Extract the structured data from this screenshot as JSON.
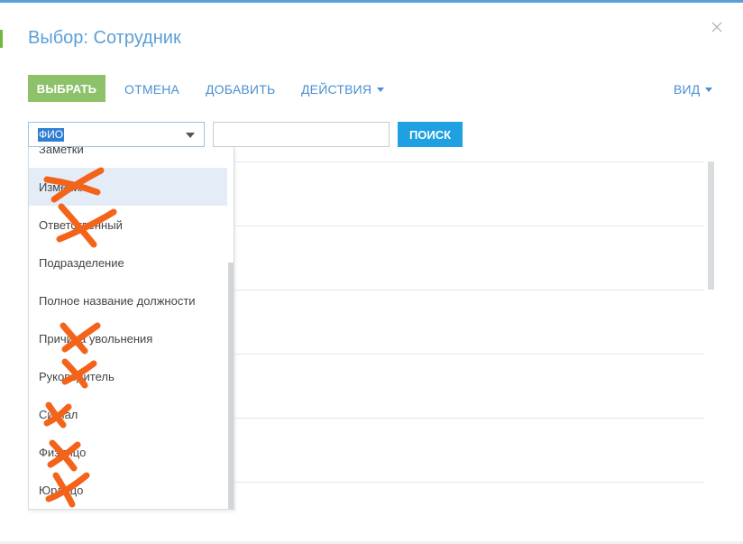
{
  "dialog": {
    "title": "Выбор: Сотрудник"
  },
  "toolbar": {
    "select_label": "ВЫБРАТЬ",
    "cancel_label": "ОТМЕНА",
    "add_label": "ДОБАВИТЬ",
    "actions_label": "ДЕЙСТВИЯ",
    "view_label": "ВИД"
  },
  "filter": {
    "field_value": "ФИО",
    "search_value": "",
    "search_button": "ПОИСК"
  },
  "dropdown": {
    "items": [
      {
        "label": "Заметки"
      },
      {
        "label": "Изменил"
      },
      {
        "label": "Ответственный"
      },
      {
        "label": "Подразделение"
      },
      {
        "label": "Полное название должности"
      },
      {
        "label": "Причина увольнения"
      },
      {
        "label": "Руководитель"
      },
      {
        "label": "Сигнал"
      },
      {
        "label": "Физлицо"
      },
      {
        "label": "Юрлицо"
      }
    ],
    "highlighted_index": 1
  },
  "colors": {
    "accent": "#5aa0d8",
    "select_button": "#8dc26b",
    "search_button": "#1fa0e0",
    "cross_out": "#f4631a"
  }
}
